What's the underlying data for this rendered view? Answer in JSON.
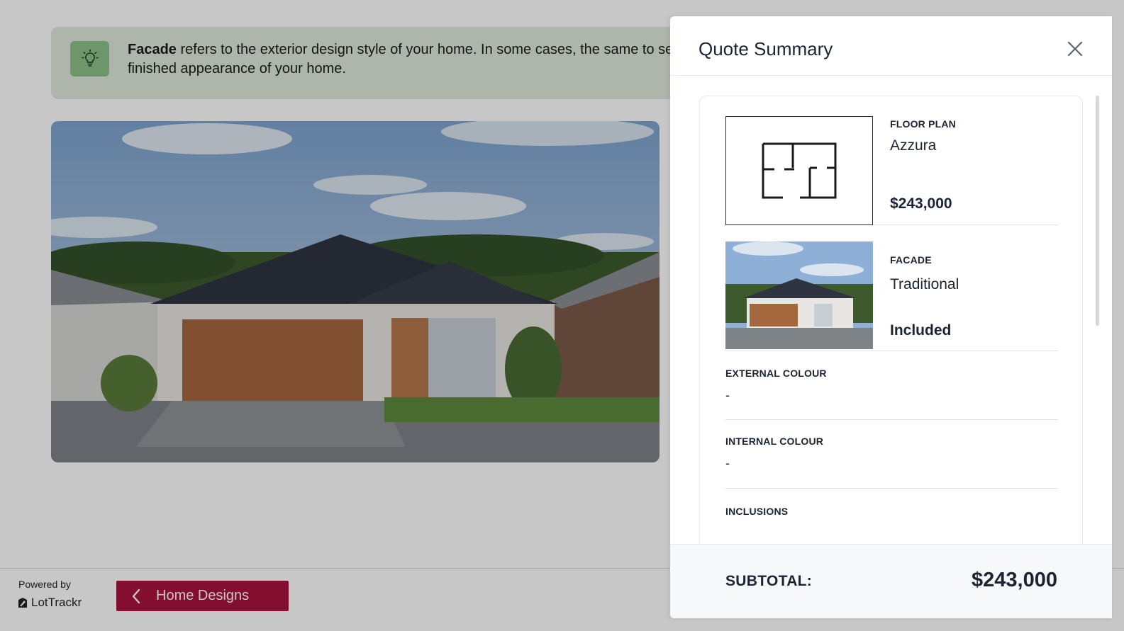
{
  "tip": {
    "bold": "Facade",
    "text": " refers to the exterior design style of your home. In some cases, the same to select the finished appearance of your home.",
    "icon": "lightbulb-icon"
  },
  "footer": {
    "powered_by": "Powered by",
    "brand": "LotTrackr",
    "back_label": "Home Designs"
  },
  "quote": {
    "title": "Quote Summary",
    "floor_plan": {
      "category": "FLOOR PLAN",
      "name": "Azzura",
      "price": "$243,000"
    },
    "facade": {
      "category": "FACADE",
      "name": "Traditional",
      "price": "Included"
    },
    "external_colour": {
      "category": "EXTERNAL COLOUR",
      "value": "-"
    },
    "internal_colour": {
      "category": "INTERNAL COLOUR",
      "value": "-"
    },
    "inclusions": {
      "category": "INCLUSIONS"
    },
    "subtotal_label": "SUBTOTAL:",
    "subtotal_value": "$243,000"
  },
  "colors": {
    "accent": "#a8133d",
    "tip_bg": "#dfeadb",
    "tip_icon_bg": "#8cc08a"
  }
}
